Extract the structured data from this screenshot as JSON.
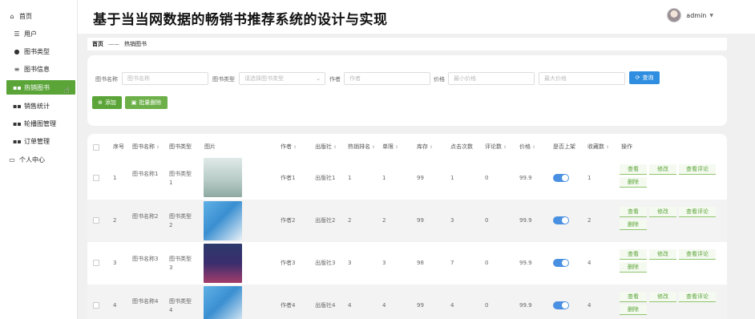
{
  "app": {
    "title": "基于当当网数据的畅销书推荐系统的设计与实现"
  },
  "user": {
    "name": "admin"
  },
  "sidebar": {
    "items": [
      {
        "label": "首页",
        "icon": "home-icon"
      },
      {
        "label": "用户",
        "icon": "sliders-icon"
      },
      {
        "label": "图书类型",
        "icon": "user-icon"
      },
      {
        "label": "图书信息",
        "icon": "list-icon"
      },
      {
        "label": "热销图书",
        "icon": "grid-icon",
        "active": true
      },
      {
        "label": "销售统计",
        "icon": "grid-icon"
      },
      {
        "label": "轮播图管理",
        "icon": "grid-icon"
      },
      {
        "label": "订单管理",
        "icon": "grid-icon"
      },
      {
        "label": "个人中心",
        "icon": "monitor-icon"
      }
    ]
  },
  "breadcrumb": {
    "home": "首页",
    "separator": "——",
    "current": "热销图书"
  },
  "search": {
    "name_label": "图书名称",
    "name_placeholder": "图书名称",
    "type_label": "图书类型",
    "type_placeholder": "请选择图书类型",
    "author_label": "作者",
    "author_placeholder": "作者",
    "price_label": "价格",
    "min_price_placeholder": "最小价格",
    "max_price_placeholder": "最大价格",
    "query_button": "查询"
  },
  "actions": {
    "add_button": "添加",
    "bulk_delete_button": "批量删除"
  },
  "table": {
    "headers": [
      "序号",
      "图书名称",
      "图书类型",
      "图片",
      "作者",
      "出版社",
      "热销排名",
      "单限",
      "库存",
      "点击次数",
      "评论数",
      "价格",
      "是否上架",
      "收藏数",
      "操作"
    ],
    "rows": [
      {
        "index": "1",
        "name": "图书名称1",
        "type": "图书类型1",
        "author": "作者1",
        "publisher": "出版社1",
        "rank": "1",
        "limit": "1",
        "stock": "99",
        "clicks": "1",
        "comments": "0",
        "price": "99.9",
        "on_shelf": true,
        "favorites": "1"
      },
      {
        "index": "2",
        "name": "图书名称2",
        "type": "图书类型2",
        "author": "作者2",
        "publisher": "出版社2",
        "rank": "2",
        "limit": "2",
        "stock": "99",
        "clicks": "3",
        "comments": "0",
        "price": "99.9",
        "on_shelf": true,
        "favorites": "2"
      },
      {
        "index": "3",
        "name": "图书名称3",
        "type": "图书类型3",
        "author": "作者3",
        "publisher": "出版社3",
        "rank": "3",
        "limit": "3",
        "stock": "98",
        "clicks": "7",
        "comments": "0",
        "price": "99.9",
        "on_shelf": true,
        "favorites": "4"
      },
      {
        "index": "4",
        "name": "图书名称4",
        "type": "图书类型4",
        "author": "作者4",
        "publisher": "出版社4",
        "rank": "4",
        "limit": "4",
        "stock": "99",
        "clicks": "4",
        "comments": "0",
        "price": "99.9",
        "on_shelf": true,
        "favorites": "4"
      }
    ],
    "operations": {
      "view": "查看",
      "edit": "修改",
      "view_comments": "查看评论",
      "delete": "删除"
    }
  },
  "colors": {
    "accent_green": "#5aa438",
    "query_blue": "#2f8ee0",
    "toggle_blue": "#4a90e2"
  }
}
